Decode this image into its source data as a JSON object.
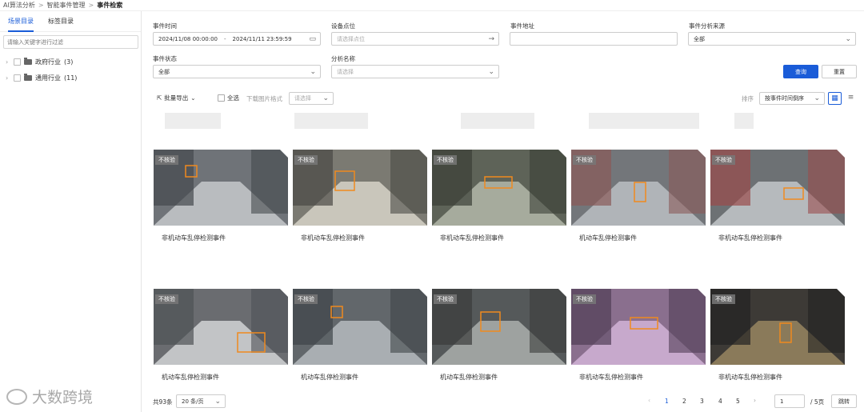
{
  "breadcrumb": [
    "AI算法分析",
    "智能事件管理",
    "事件检索"
  ],
  "sidebar": {
    "tabs": [
      {
        "label": "场景目录",
        "active": true
      },
      {
        "label": "标签目录",
        "active": false
      }
    ],
    "filter_placeholder": "请输入关键字进行过滤",
    "tree": [
      {
        "label": "政府行业",
        "count": "(3)"
      },
      {
        "label": "通用行业",
        "count": "(11)"
      }
    ]
  },
  "filters": {
    "event_time_label": "事件时间",
    "start_time": "2024/11/08 00:00:00",
    "range_sep": "-",
    "end_time": "2024/11/11 23:59:59",
    "device_label": "设备点位",
    "device_placeholder": "请选择点位",
    "address_label": "事件地址",
    "address_value": "",
    "source_label": "事件分析来源",
    "source_value": "全部",
    "status_label": "事件状态",
    "status_value": "全部",
    "analysis_label": "分析名称",
    "analysis_placeholder": "请选择",
    "query_label": "查询",
    "reset_label": "重置"
  },
  "toolbar": {
    "batch_export": "批量导出",
    "select_all": "全选",
    "download_format_label": "下载图片格式",
    "download_format_placeholder": "请选择",
    "sort_label": "排序",
    "sort_value": "按事件时间倒序"
  },
  "cards": [
    {
      "tag": "不核验",
      "title": "非机动车乱停检测事件"
    },
    {
      "tag": "不核验",
      "title": "非机动车乱停检测事件"
    },
    {
      "tag": "不核验",
      "title": "非机动车乱停检测事件"
    },
    {
      "tag": "不核验",
      "title": "机动车乱停检测事件"
    },
    {
      "tag": "不核验",
      "title": "非机动车乱停检测事件"
    },
    {
      "tag": "不核验",
      "title": "机动车乱停检测事件"
    },
    {
      "tag": "不核验",
      "title": "机动车乱停检测事件"
    },
    {
      "tag": "不核验",
      "title": "机动车乱停检测事件"
    },
    {
      "tag": "不核验",
      "title": "非机动车乱停检测事件"
    },
    {
      "tag": "不核验",
      "title": "非机动车乱停检测事件"
    }
  ],
  "pagination": {
    "total": "共93条",
    "page_size": "20 条/页",
    "pages": [
      "1",
      "2",
      "3",
      "4",
      "5"
    ],
    "current": "1",
    "jump_value": "1",
    "total_pages": "/ 5页",
    "jump_label": "跳转"
  },
  "logo_text": "大数跨境",
  "colors": {
    "primary": "#1a5cd8",
    "tag_bg": "#787878"
  }
}
